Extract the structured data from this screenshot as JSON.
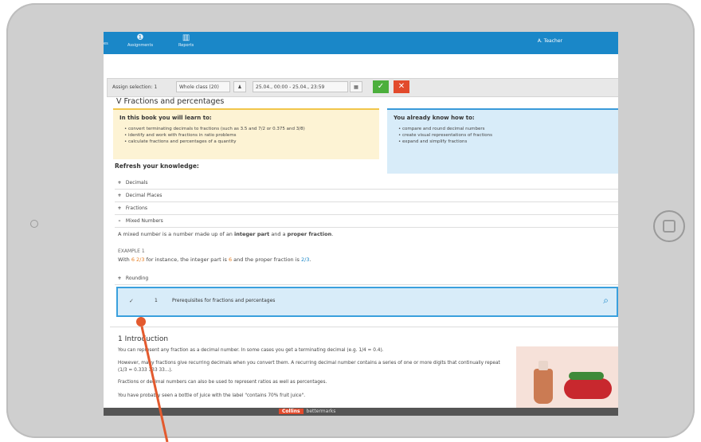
{
  "nav": {
    "items": [
      {
        "label": "es",
        "icon": ""
      },
      {
        "label": "Assignments",
        "icon": "info-icon"
      },
      {
        "label": "Reports",
        "icon": "bar-chart-icon"
      }
    ],
    "user": "A. Teacher",
    "accent": "#1a87c8"
  },
  "assign": {
    "label": "Assign selection: 1",
    "class": "Whole class (20)",
    "dates": "25.04., 00:00 - 25.04., 23:59",
    "ok": "✓",
    "cancel": "✕"
  },
  "page_title": "V Fractions and percentages",
  "learn": {
    "heading": "In this book you will learn to:",
    "items": [
      "convert terminating decimals to fractions (such as 3.5 and 7/2 or 0.375 and 3/8)",
      "identify and work with fractions in ratio problems",
      "calculate fractions and percentages of a quantity"
    ]
  },
  "know": {
    "heading": "You already know how to:",
    "items": [
      "compare and round decimal numbers",
      "create visual representations of fractions",
      "expand and simplify fractions"
    ]
  },
  "refresh": {
    "heading": "Refresh your knowledge:",
    "sections": [
      {
        "sign": "+",
        "label": "Decimals"
      },
      {
        "sign": "+",
        "label": "Decimal Places"
      },
      {
        "sign": "+",
        "label": "Fractions"
      },
      {
        "sign": "–",
        "label": "Mixed Numbers"
      }
    ],
    "mixed_text_1": "A mixed number is a number made up of an ",
    "mixed_bold_1": "integer part",
    "mixed_text_2": " and a ",
    "mixed_bold_2": "proper fraction",
    "mixed_text_3": ".",
    "example_label": "EXAMPLE 1",
    "example_text_1": "With ",
    "example_number": "6 2/3",
    "example_text_2": " for instance, the integer part is ",
    "example_int": "6",
    "example_text_3": " and the proper fraction is ",
    "example_frac": "2/3",
    "example_text_4": ".",
    "rounding": {
      "sign": "+",
      "label": "Rounding"
    }
  },
  "prereq": {
    "check": "✓",
    "number": "1",
    "label": "Prerequisites for fractions and percentages"
  },
  "intro": {
    "heading": "1 Introduction",
    "paragraphs": [
      "You can represent any fraction as a decimal number. In some cases you get a terminating decimal (e.g. 1/4 = 0.4).",
      "However, many fractions give recurring decimals when you convert them. A recurring decimal number contains a series of one or more digits that continually repeat (1/3 = 0.333 333 33...).",
      "Fractions or decimal numbers can also be used to represent ratios as well as percentages.",
      "You have probably seen a bottle of juice with the label \"contains 70% fruit juice\"."
    ]
  },
  "footer": {
    "brand_1": "Collins",
    "brand_2": "bettermarks"
  }
}
